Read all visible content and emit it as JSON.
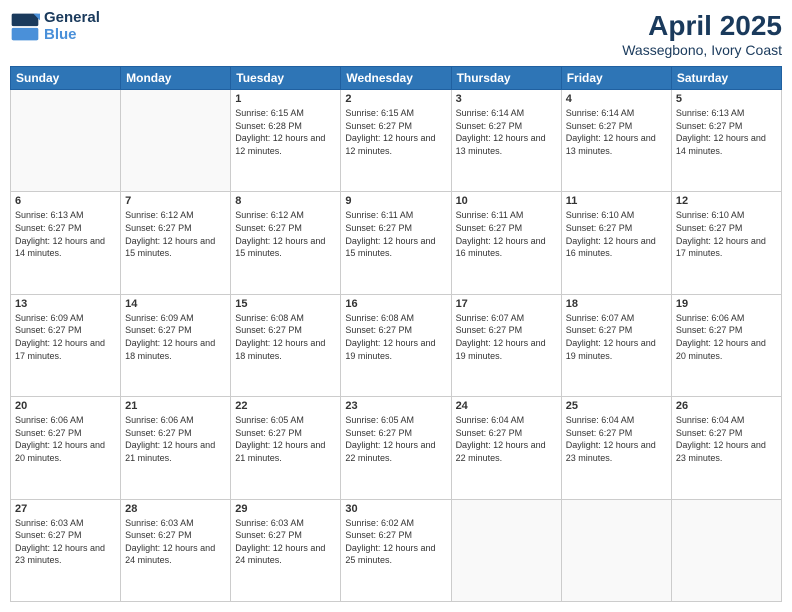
{
  "logo": {
    "line1": "General",
    "line2": "Blue"
  },
  "title": "April 2025",
  "subtitle": "Wassegbono, Ivory Coast",
  "weekdays": [
    "Sunday",
    "Monday",
    "Tuesday",
    "Wednesday",
    "Thursday",
    "Friday",
    "Saturday"
  ],
  "weeks": [
    [
      {
        "day": "",
        "sunrise": "",
        "sunset": "",
        "daylight": ""
      },
      {
        "day": "",
        "sunrise": "",
        "sunset": "",
        "daylight": ""
      },
      {
        "day": "1",
        "sunrise": "Sunrise: 6:15 AM",
        "sunset": "Sunset: 6:28 PM",
        "daylight": "Daylight: 12 hours and 12 minutes."
      },
      {
        "day": "2",
        "sunrise": "Sunrise: 6:15 AM",
        "sunset": "Sunset: 6:27 PM",
        "daylight": "Daylight: 12 hours and 12 minutes."
      },
      {
        "day": "3",
        "sunrise": "Sunrise: 6:14 AM",
        "sunset": "Sunset: 6:27 PM",
        "daylight": "Daylight: 12 hours and 13 minutes."
      },
      {
        "day": "4",
        "sunrise": "Sunrise: 6:14 AM",
        "sunset": "Sunset: 6:27 PM",
        "daylight": "Daylight: 12 hours and 13 minutes."
      },
      {
        "day": "5",
        "sunrise": "Sunrise: 6:13 AM",
        "sunset": "Sunset: 6:27 PM",
        "daylight": "Daylight: 12 hours and 14 minutes."
      }
    ],
    [
      {
        "day": "6",
        "sunrise": "Sunrise: 6:13 AM",
        "sunset": "Sunset: 6:27 PM",
        "daylight": "Daylight: 12 hours and 14 minutes."
      },
      {
        "day": "7",
        "sunrise": "Sunrise: 6:12 AM",
        "sunset": "Sunset: 6:27 PM",
        "daylight": "Daylight: 12 hours and 15 minutes."
      },
      {
        "day": "8",
        "sunrise": "Sunrise: 6:12 AM",
        "sunset": "Sunset: 6:27 PM",
        "daylight": "Daylight: 12 hours and 15 minutes."
      },
      {
        "day": "9",
        "sunrise": "Sunrise: 6:11 AM",
        "sunset": "Sunset: 6:27 PM",
        "daylight": "Daylight: 12 hours and 15 minutes."
      },
      {
        "day": "10",
        "sunrise": "Sunrise: 6:11 AM",
        "sunset": "Sunset: 6:27 PM",
        "daylight": "Daylight: 12 hours and 16 minutes."
      },
      {
        "day": "11",
        "sunrise": "Sunrise: 6:10 AM",
        "sunset": "Sunset: 6:27 PM",
        "daylight": "Daylight: 12 hours and 16 minutes."
      },
      {
        "day": "12",
        "sunrise": "Sunrise: 6:10 AM",
        "sunset": "Sunset: 6:27 PM",
        "daylight": "Daylight: 12 hours and 17 minutes."
      }
    ],
    [
      {
        "day": "13",
        "sunrise": "Sunrise: 6:09 AM",
        "sunset": "Sunset: 6:27 PM",
        "daylight": "Daylight: 12 hours and 17 minutes."
      },
      {
        "day": "14",
        "sunrise": "Sunrise: 6:09 AM",
        "sunset": "Sunset: 6:27 PM",
        "daylight": "Daylight: 12 hours and 18 minutes."
      },
      {
        "day": "15",
        "sunrise": "Sunrise: 6:08 AM",
        "sunset": "Sunset: 6:27 PM",
        "daylight": "Daylight: 12 hours and 18 minutes."
      },
      {
        "day": "16",
        "sunrise": "Sunrise: 6:08 AM",
        "sunset": "Sunset: 6:27 PM",
        "daylight": "Daylight: 12 hours and 19 minutes."
      },
      {
        "day": "17",
        "sunrise": "Sunrise: 6:07 AM",
        "sunset": "Sunset: 6:27 PM",
        "daylight": "Daylight: 12 hours and 19 minutes."
      },
      {
        "day": "18",
        "sunrise": "Sunrise: 6:07 AM",
        "sunset": "Sunset: 6:27 PM",
        "daylight": "Daylight: 12 hours and 19 minutes."
      },
      {
        "day": "19",
        "sunrise": "Sunrise: 6:06 AM",
        "sunset": "Sunset: 6:27 PM",
        "daylight": "Daylight: 12 hours and 20 minutes."
      }
    ],
    [
      {
        "day": "20",
        "sunrise": "Sunrise: 6:06 AM",
        "sunset": "Sunset: 6:27 PM",
        "daylight": "Daylight: 12 hours and 20 minutes."
      },
      {
        "day": "21",
        "sunrise": "Sunrise: 6:06 AM",
        "sunset": "Sunset: 6:27 PM",
        "daylight": "Daylight: 12 hours and 21 minutes."
      },
      {
        "day": "22",
        "sunrise": "Sunrise: 6:05 AM",
        "sunset": "Sunset: 6:27 PM",
        "daylight": "Daylight: 12 hours and 21 minutes."
      },
      {
        "day": "23",
        "sunrise": "Sunrise: 6:05 AM",
        "sunset": "Sunset: 6:27 PM",
        "daylight": "Daylight: 12 hours and 22 minutes."
      },
      {
        "day": "24",
        "sunrise": "Sunrise: 6:04 AM",
        "sunset": "Sunset: 6:27 PM",
        "daylight": "Daylight: 12 hours and 22 minutes."
      },
      {
        "day": "25",
        "sunrise": "Sunrise: 6:04 AM",
        "sunset": "Sunset: 6:27 PM",
        "daylight": "Daylight: 12 hours and 23 minutes."
      },
      {
        "day": "26",
        "sunrise": "Sunrise: 6:04 AM",
        "sunset": "Sunset: 6:27 PM",
        "daylight": "Daylight: 12 hours and 23 minutes."
      }
    ],
    [
      {
        "day": "27",
        "sunrise": "Sunrise: 6:03 AM",
        "sunset": "Sunset: 6:27 PM",
        "daylight": "Daylight: 12 hours and 23 minutes."
      },
      {
        "day": "28",
        "sunrise": "Sunrise: 6:03 AM",
        "sunset": "Sunset: 6:27 PM",
        "daylight": "Daylight: 12 hours and 24 minutes."
      },
      {
        "day": "29",
        "sunrise": "Sunrise: 6:03 AM",
        "sunset": "Sunset: 6:27 PM",
        "daylight": "Daylight: 12 hours and 24 minutes."
      },
      {
        "day": "30",
        "sunrise": "Sunrise: 6:02 AM",
        "sunset": "Sunset: 6:27 PM",
        "daylight": "Daylight: 12 hours and 25 minutes."
      },
      {
        "day": "",
        "sunrise": "",
        "sunset": "",
        "daylight": ""
      },
      {
        "day": "",
        "sunrise": "",
        "sunset": "",
        "daylight": ""
      },
      {
        "day": "",
        "sunrise": "",
        "sunset": "",
        "daylight": ""
      }
    ]
  ]
}
